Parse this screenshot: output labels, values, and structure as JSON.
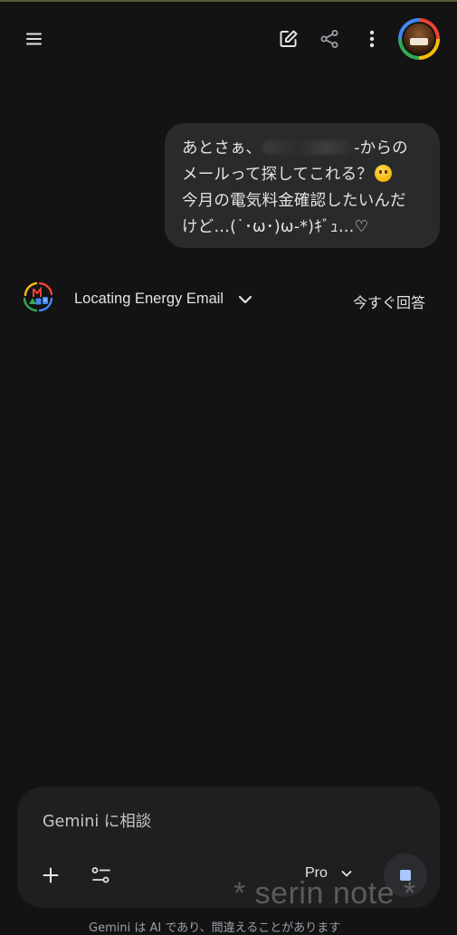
{
  "conversation": {
    "user_message": {
      "line1_start": "あとさぁ、",
      "line1_end": "-からの",
      "line2": "メールって探してこれる？",
      "line3": "今月の電気料金確認したいんだ",
      "line4": "けど…(˙･ω･)ω-*)ｷﾞｭ…♡"
    },
    "assistant": {
      "thinking_title": "Locating Energy Email",
      "answer_now_label": "今すぐ回答"
    }
  },
  "composer": {
    "placeholder": "Gemini に相談",
    "model_label": "Pro"
  },
  "footer": {
    "disclaimer": "Gemini は AI であり、間違えることがあります"
  },
  "watermark": "* serin note *",
  "colors": {
    "background": "#131314",
    "bubble": "#282a2c",
    "composer": "#1e1f20",
    "stop_icon": "#a8c7fa"
  },
  "icons": {
    "menu": "hamburger-menu-icon",
    "new_chat": "edit-icon",
    "share": "share-icon",
    "more": "more-vert-icon",
    "add": "plus-icon",
    "tools": "tune-icon",
    "stop": "stop-icon"
  }
}
